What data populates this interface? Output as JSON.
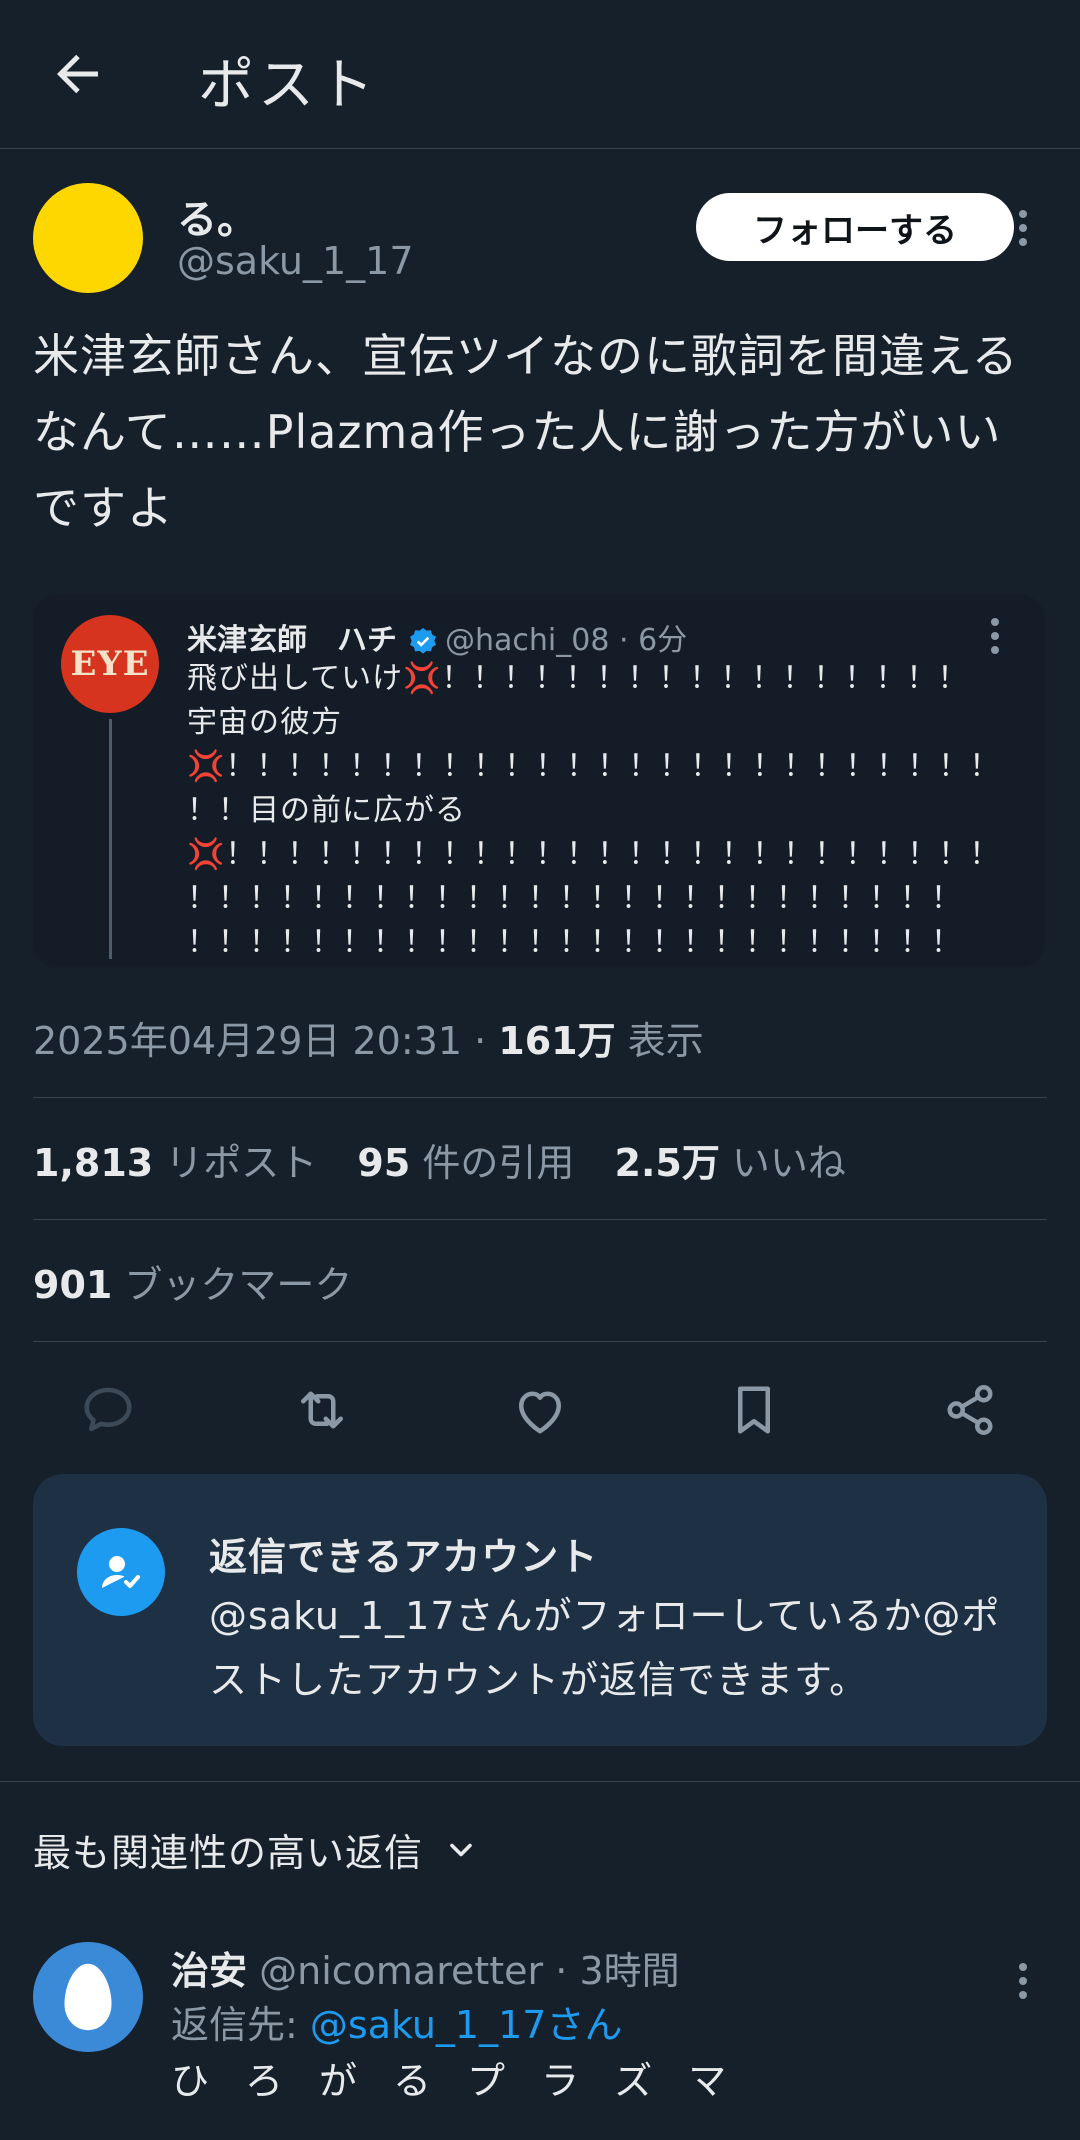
{
  "header": {
    "title": "ポスト",
    "back_icon": "arrow-left-icon"
  },
  "author": {
    "name": "る。",
    "handle": "@saku_1_17",
    "avatar_color": "#ffd700",
    "follow_label": "フォローする"
  },
  "post": {
    "text": "米津玄師さん、宣伝ツイなのに歌詞を間違えるなんて……Plazma作った人に謝った方がいいですよ"
  },
  "quote": {
    "avatar_text": "EYE",
    "name": "米津玄師　ハチ",
    "handle": "@hachi_08",
    "separator": "·",
    "time": "6分",
    "text": "飛び出していけ💢！！！！！！！！！！！！！！！！！\n宇宙の彼方\n💢！！！！！！！！！！！！！！！！！！！！！！！！！\n！！目の前に広がる\n💢！！！！！！！！！！！！！！！！！！！！！！！！！\n！！！！！！！！！！！！！！！！！！！！！！！！！\n！！！！！！！！！！！！！！！！！！！！！！！！！"
  },
  "meta": {
    "datetime": "2025年04月29日 20:31",
    "separator": "·",
    "views_count": "161万",
    "views_label": "表示"
  },
  "stats": {
    "reposts_count": "1,813",
    "reposts_label": "リポスト",
    "quotes_count": "95",
    "quotes_label": "件の引用",
    "likes_count": "2.5万",
    "likes_label": "いいね",
    "bookmarks_count": "901",
    "bookmarks_label": "ブックマーク"
  },
  "actions": [
    "reply-icon",
    "repost-icon",
    "like-icon",
    "bookmark-icon",
    "share-icon"
  ],
  "reply_restriction": {
    "title": "返信できるアカウント",
    "body": "@saku_1_17さんがフォローしているか@ポストしたアカウントが返信できます。"
  },
  "sort": {
    "label": "最も関連性の高い返信"
  },
  "reply": {
    "name": "治安",
    "handle": "@nicomaretter",
    "separator": "·",
    "time": "3時間",
    "to_label": "返信先:",
    "to_handle": "@saku_1_17さん",
    "text": "ひろがるプラズマ"
  },
  "colors": {
    "background": "#15202b",
    "accent": "#1d9bf0",
    "text": "#e7e9ea",
    "secondary": "#8b98a5"
  }
}
